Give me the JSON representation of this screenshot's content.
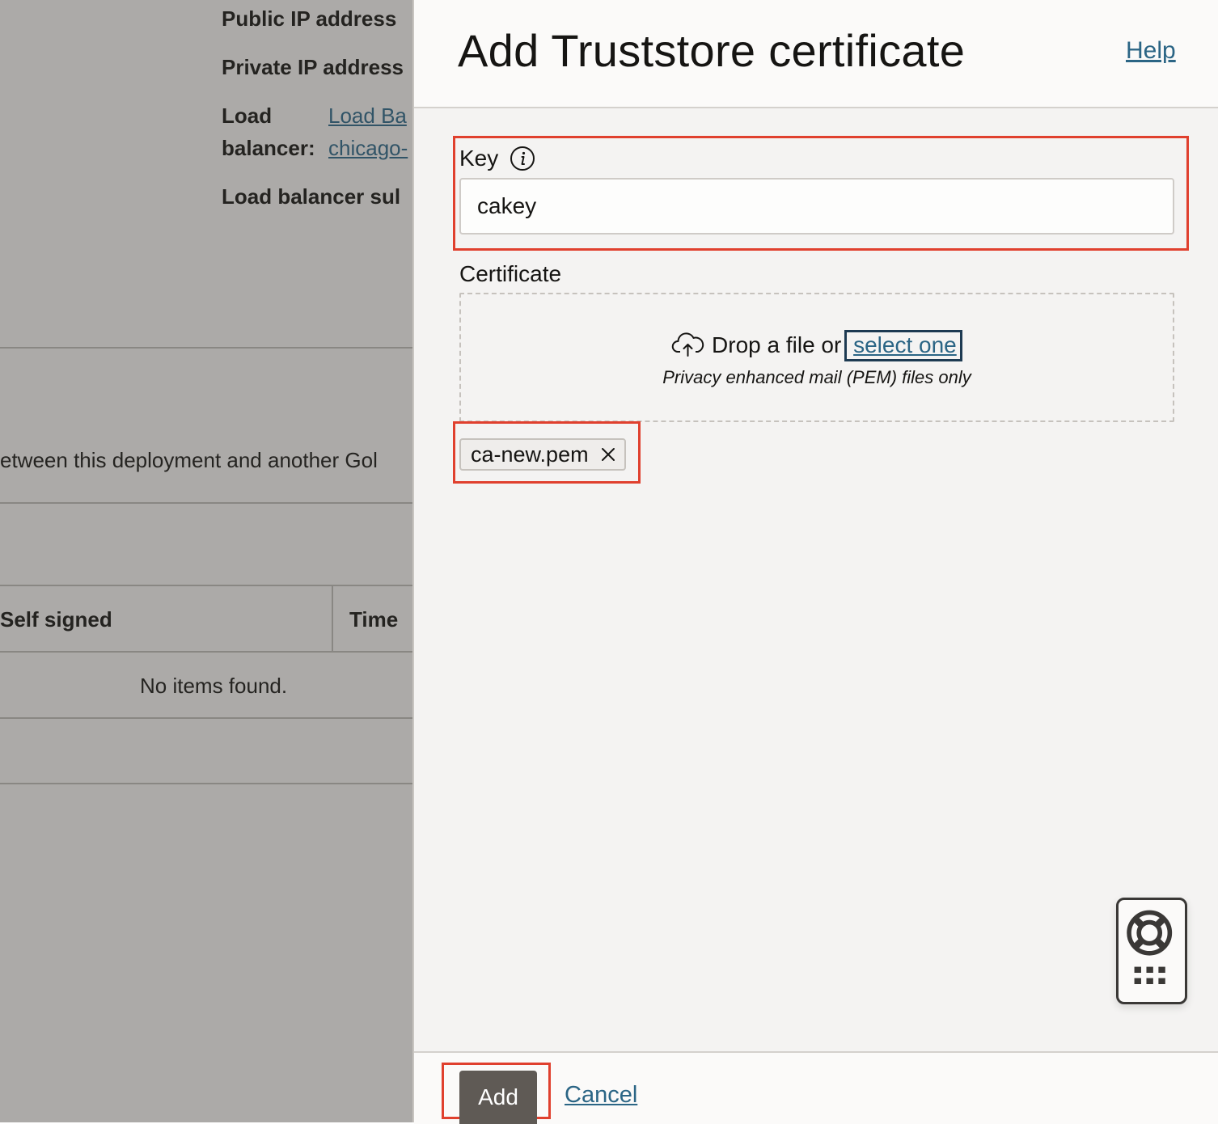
{
  "background": {
    "details": {
      "public_ip_label": "Public IP address",
      "private_ip_label": "Private IP address",
      "load_balancer_label_line1": "Load",
      "load_balancer_label_line2": "balancer:",
      "load_balancer_link1": "Load Ba",
      "load_balancer_link2": "chicago-",
      "lb_subnet_label": "Load balancer sul"
    },
    "description_fragment": "etween this deployment and another Gol",
    "table": {
      "columns": [
        "Self signed",
        "Time"
      ],
      "empty_message": "No items found."
    }
  },
  "drawer": {
    "title": "Add Truststore certificate",
    "help_label": "Help",
    "key": {
      "label": "Key",
      "value": "cakey"
    },
    "certificate": {
      "label": "Certificate",
      "drop_text": "Drop a file or",
      "select_link": "select one",
      "hint": "Privacy enhanced mail (PEM) files only",
      "selected_file": "ca-new.pem"
    },
    "footer": {
      "add_label": "Add",
      "cancel_label": "Cancel"
    }
  },
  "colors": {
    "link": "#2b6585",
    "primary_button": "#5f5a55",
    "highlight": "#e0402e"
  }
}
